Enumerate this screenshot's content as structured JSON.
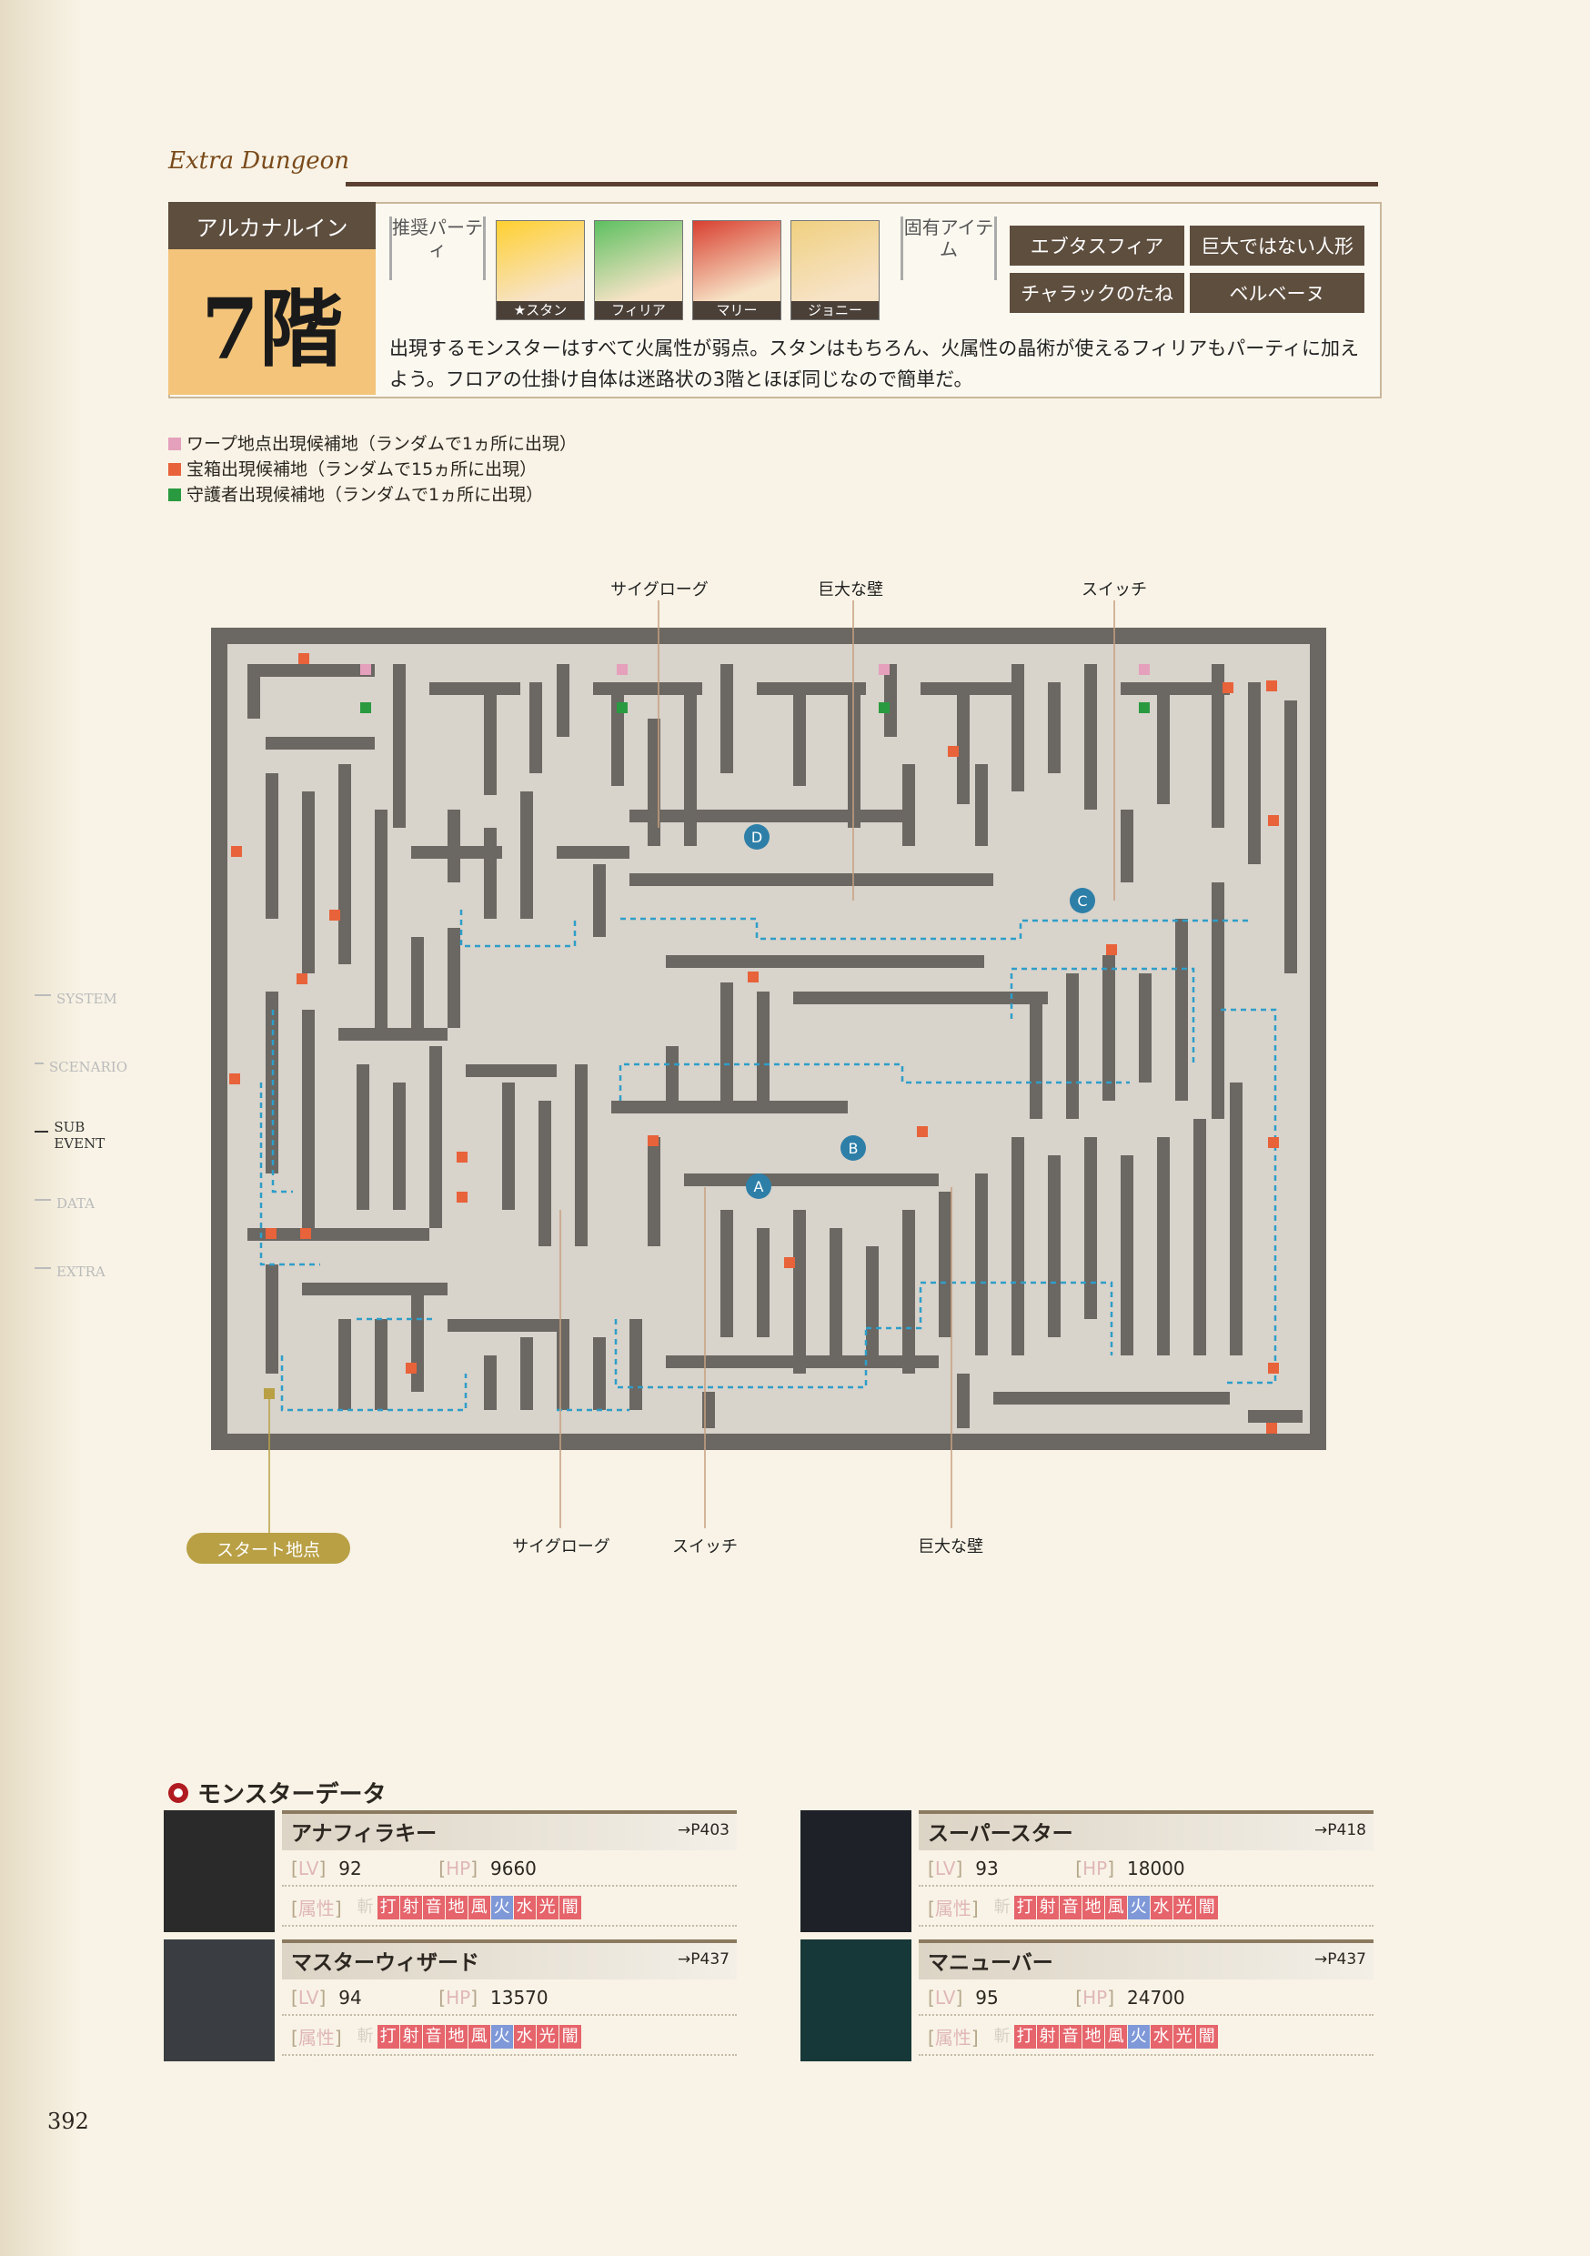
{
  "header": {
    "series": "Extra Dungeon",
    "area": "アルカナルイン",
    "floor": "7階"
  },
  "party": {
    "label": "推奨パーティ",
    "members": [
      {
        "name": "★スタン",
        "color": "#ffd030"
      },
      {
        "name": "フィリア",
        "color": "#5dc060"
      },
      {
        "name": "マリー",
        "color": "#d84030"
      },
      {
        "name": "ジョニー",
        "color": "#f0d080"
      }
    ]
  },
  "items": {
    "label": "固有アイテム",
    "list": [
      "エブタスフィア",
      "巨大ではない人形",
      "チャラックのたね",
      "ベルベーヌ"
    ]
  },
  "description": "出現するモンスターはすべて火属性が弱点。スタンはもちろん、火属性の晶術が使えるフィリアもパーティに加えよう。フロアの仕掛け自体は迷路状の3階とほぼ同じなので簡単だ。",
  "legend": [
    {
      "text": "ワープ地点出現候補地（ランダムで1ヵ所に出現）",
      "color": "#e5a0bc"
    },
    {
      "text": "宝箱出現候補地（ランダムで15ヵ所に出現）",
      "color": "#e8623a"
    },
    {
      "text": "守護者出現候補地（ランダムで1ヵ所に出現）",
      "color": "#2a9a40"
    }
  ],
  "map": {
    "top_labels": [
      "サイグローグ",
      "巨大な壁",
      "スイッチ"
    ],
    "bottom_labels": [
      "サイグローグ",
      "スイッチ",
      "巨大な壁"
    ],
    "start": "スタート地点",
    "markers": [
      "A",
      "B",
      "C",
      "D"
    ]
  },
  "side_tabs": [
    {
      "label": "SYSTEM",
      "active": false
    },
    {
      "label": "SCENARIO",
      "active": false
    },
    {
      "label": "SUB EVENT",
      "active": true
    },
    {
      "label": "DATA",
      "active": false
    },
    {
      "label": "EXTRA",
      "active": false
    }
  ],
  "monster_section": {
    "title": "モンスターデータ",
    "lv_label": "LV",
    "hp_label": "HP",
    "attr_label": "属性",
    "elements": [
      "斬",
      "打",
      "射",
      "音",
      "地",
      "風",
      "火",
      "水",
      "光",
      "闇"
    ],
    "monsters": [
      {
        "name": "アナフィラキー",
        "ref": "→P403",
        "lv": "92",
        "hp": "9660"
      },
      {
        "name": "スーパースター",
        "ref": "→P418",
        "lv": "93",
        "hp": "18000"
      },
      {
        "name": "マスターウィザード",
        "ref": "→P437",
        "lv": "94",
        "hp": "13570"
      },
      {
        "name": "マニューバー",
        "ref": "→P437",
        "lv": "95",
        "hp": "24700"
      }
    ]
  },
  "page_number": "392"
}
